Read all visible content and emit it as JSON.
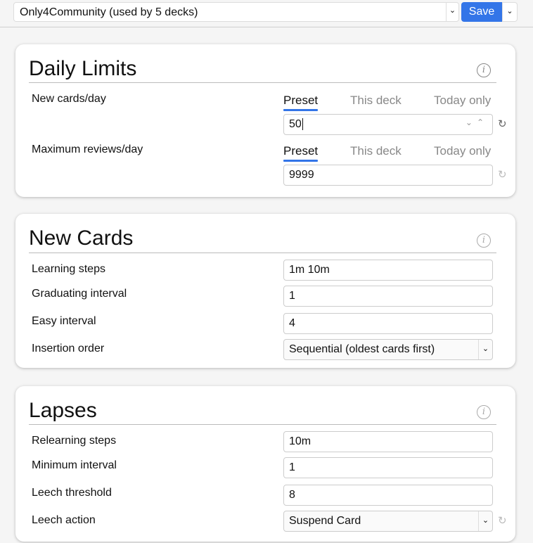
{
  "header": {
    "preset": "Only4Community (used by 5 decks)",
    "save": "Save"
  },
  "daily_limits": {
    "title": "Daily Limits",
    "tabs": [
      "Preset",
      "This deck",
      "Today only"
    ],
    "new_cards": {
      "label": "New cards/day",
      "value": "50"
    },
    "max_reviews": {
      "label": "Maximum reviews/day",
      "value": "9999"
    }
  },
  "new_cards": {
    "title": "New Cards",
    "rows": [
      {
        "label": "Learning steps",
        "value": "1m 10m"
      },
      {
        "label": "Graduating interval",
        "value": "1"
      },
      {
        "label": "Easy interval",
        "value": "4"
      },
      {
        "label": "Insertion order",
        "value": "Sequential (oldest cards first)"
      }
    ]
  },
  "lapses": {
    "title": "Lapses",
    "rows": [
      {
        "label": "Relearning steps",
        "value": "10m"
      },
      {
        "label": "Minimum interval",
        "value": "1"
      },
      {
        "label": "Leech threshold",
        "value": "8"
      },
      {
        "label": "Leech action",
        "value": "Suspend Card"
      }
    ]
  },
  "colors": {
    "accent": "#3375e8"
  }
}
